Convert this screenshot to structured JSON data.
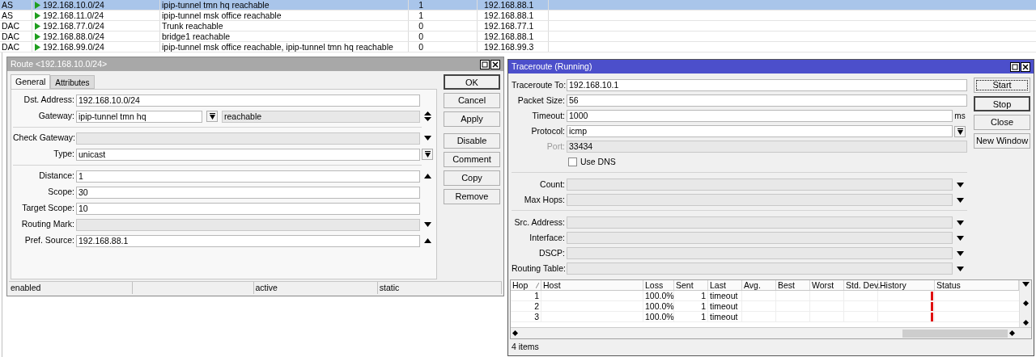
{
  "routes_table": {
    "rows": [
      {
        "type": "AS",
        "dst_address": "192.168.10.0/24",
        "gateway": "ipip-tunnel tmn hq reachable",
        "distance": "1",
        "pref_source": "192.168.88.1",
        "selected": true
      },
      {
        "type": "AS",
        "dst_address": "192.168.11.0/24",
        "gateway": "ipip-tunnel msk office reachable",
        "distance": "1",
        "pref_source": "192.168.88.1",
        "selected": false
      },
      {
        "type": "DAC",
        "dst_address": "192.168.77.0/24",
        "gateway": "Trunk reachable",
        "distance": "0",
        "pref_source": "192.168.77.1",
        "selected": false
      },
      {
        "type": "DAC",
        "dst_address": "192.168.88.0/24",
        "gateway": "bridge1 reachable",
        "distance": "0",
        "pref_source": "192.168.88.1",
        "selected": false
      },
      {
        "type": "DAC",
        "dst_address": "192.168.99.0/24",
        "gateway": "ipip-tunnel msk office reachable, ipip-tunnel tmn hq reachable",
        "distance": "0",
        "pref_source": "192.168.99.3",
        "selected": false
      }
    ]
  },
  "route_window": {
    "title": "Route <192.168.10.0/24>",
    "active": false,
    "tabs": [
      {
        "label": "General",
        "selected": true
      },
      {
        "label": "Attributes",
        "selected": false
      }
    ],
    "groups": [
      [
        {
          "label": "Dst. Address:",
          "value": "192.168.10.0/24",
          "editable": true,
          "kind": "plain"
        },
        {
          "label": "Gateway:",
          "value": "ipip-tunnel tmn hq",
          "editable": true,
          "kind": "gateway",
          "status": "reachable"
        }
      ],
      [
        {
          "label": "Check Gateway:",
          "editable": false,
          "kind": "down"
        },
        {
          "label": "Type:",
          "value": "unicast",
          "editable": true,
          "kind": "select"
        }
      ],
      [
        {
          "label": "Distance:",
          "value": "1",
          "editable": true,
          "kind": "up"
        },
        {
          "label": "Scope:",
          "value": "30",
          "editable": true,
          "kind": "plain"
        },
        {
          "label": "Target Scope:",
          "value": "10",
          "editable": true,
          "kind": "plain"
        },
        {
          "label": "Routing Mark:",
          "editable": false,
          "kind": "down"
        },
        {
          "label": "Pref. Source:",
          "value": "192.168.88.1",
          "editable": true,
          "kind": "up"
        }
      ]
    ],
    "button_groups": [
      [
        {
          "label": "OK",
          "default": true,
          "focused": false
        },
        {
          "label": "Cancel",
          "default": false,
          "focused": false
        },
        {
          "label": "Apply",
          "default": false,
          "focused": false
        }
      ],
      [
        {
          "label": "Disable",
          "default": false,
          "focused": false
        },
        {
          "label": "Comment",
          "default": false,
          "focused": false
        },
        {
          "label": "Copy",
          "default": false,
          "focused": false
        },
        {
          "label": "Remove",
          "default": false,
          "focused": false
        }
      ]
    ],
    "status_bar": {
      "state": "enabled",
      "activity": "active",
      "origin": "static"
    }
  },
  "traceroute_window": {
    "title": "Traceroute (Running)",
    "active": true,
    "groups": [
      [
        {
          "label": "Traceroute To:",
          "value": "192.168.10.1",
          "editable": true,
          "kind": "plain",
          "label_disabled": false
        },
        {
          "label": "Packet Size:",
          "value": "56",
          "editable": true,
          "kind": "plain",
          "label_disabled": false
        },
        {
          "label": "Timeout:",
          "value": "1000",
          "editable": true,
          "kind": "plain",
          "unit": "ms",
          "label_disabled": false
        },
        {
          "label": "Protocol:",
          "value": "icmp",
          "editable": true,
          "kind": "select",
          "label_disabled": false
        },
        {
          "label": "Port:",
          "value": "33434",
          "editable": false,
          "kind": "plain",
          "label_disabled": true
        }
      ],
      [
        {
          "label": "Count:",
          "editable": false,
          "kind": "down",
          "label_disabled": false
        },
        {
          "label": "Max Hops:",
          "editable": false,
          "kind": "down",
          "label_disabled": false
        }
      ],
      [
        {
          "label": "Src. Address:",
          "editable": false,
          "kind": "down",
          "label_disabled": false
        },
        {
          "label": "Interface:",
          "editable": false,
          "kind": "down",
          "label_disabled": false
        },
        {
          "label": "DSCP:",
          "editable": false,
          "kind": "down",
          "label_disabled": false
        },
        {
          "label": "Routing Table:",
          "editable": false,
          "kind": "down",
          "label_disabled": false
        }
      ]
    ],
    "use_dns": {
      "label": "Use DNS",
      "checked": false
    },
    "button_groups": [
      [
        {
          "label": "Start",
          "default": false,
          "focused": true
        },
        {
          "label": "Stop",
          "default": true,
          "focused": false
        },
        {
          "label": "Close",
          "default": false,
          "focused": false
        },
        {
          "label": "New Window",
          "default": false,
          "focused": false
        }
      ]
    ],
    "table": {
      "columns": [
        "Hop",
        "Host",
        "Loss",
        "Sent",
        "Last",
        "Avg.",
        "Best",
        "Worst",
        "Std. Dev.",
        "History",
        "Status"
      ],
      "rows": [
        {
          "hop": "1",
          "loss": "100.0%",
          "sent": "1",
          "last": "timeout"
        },
        {
          "hop": "2",
          "loss": "100.0%",
          "sent": "1",
          "last": "timeout"
        },
        {
          "hop": "3",
          "loss": "100.0%",
          "sent": "1",
          "last": "timeout"
        }
      ]
    },
    "status_bar": "4 items"
  }
}
